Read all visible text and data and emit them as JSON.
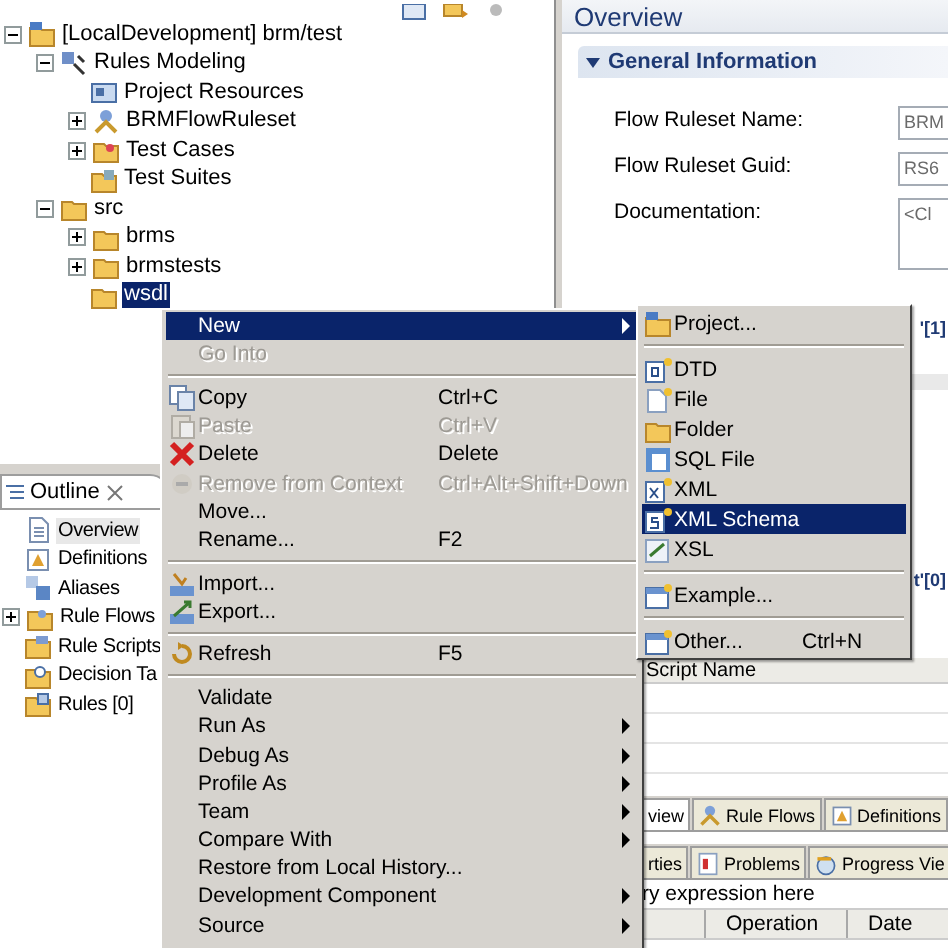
{
  "project_tree": [
    {
      "label": "[LocalDevelopment] brm/test",
      "kind": "project",
      "expanded": true,
      "selected": false,
      "children": [
        {
          "label": "Rules Modeling",
          "kind": "model",
          "expanded": true,
          "selected": false,
          "children": [
            {
              "label": "Project Resources",
              "kind": "resources",
              "selected": false
            },
            {
              "label": "BRMFlowRuleset",
              "kind": "flow",
              "expanded": false,
              "selected": false
            },
            {
              "label": "Test Cases",
              "kind": "cases",
              "expanded": false,
              "selected": false
            },
            {
              "label": "Test Suites",
              "kind": "suites",
              "selected": false
            }
          ]
        },
        {
          "label": "src",
          "kind": "folder",
          "expanded": true,
          "selected": false,
          "children": [
            {
              "label": "brms",
              "kind": "folder",
              "expanded": false,
              "selected": false
            },
            {
              "label": "brmstests",
              "kind": "folder",
              "expanded": false,
              "selected": false
            },
            {
              "label": "wsdl",
              "kind": "folder",
              "selected": true
            }
          ]
        }
      ]
    }
  ],
  "outline": {
    "title": "Outline",
    "items": [
      {
        "label": "Overview",
        "kind": "document",
        "selected": true
      },
      {
        "label": "Definitions",
        "kind": "definition",
        "selected": false
      },
      {
        "label": "Aliases",
        "kind": "alias",
        "selected": false
      },
      {
        "label": "Rule Flows",
        "kind": "flows",
        "expanded": false,
        "selected": false
      },
      {
        "label": "Rule Scripts",
        "kind": "scripts",
        "selected": false
      },
      {
        "label": "Decision Ta",
        "kind": "tables",
        "selected": false
      },
      {
        "label": "Rules [0]",
        "kind": "rules",
        "selected": false
      }
    ]
  },
  "editor": {
    "title": "Overview",
    "section": {
      "title": "General Information",
      "expanded": true
    },
    "fields": [
      {
        "label": "Flow Ruleset Name:",
        "value": "BRM",
        "kind": "line"
      },
      {
        "label": "Flow Ruleset Guid:",
        "value": "RS6",
        "kind": "line"
      },
      {
        "label": "Documentation:",
        "value": "<Cl",
        "kind": "area"
      }
    ],
    "section_2_title": "'[1]",
    "section_3_title": "t'[0]",
    "table_header": "Script Name",
    "tabs": [
      {
        "label": "view",
        "selected": true
      },
      {
        "label": "Rule Flows",
        "selected": false
      },
      {
        "label": "Definitions",
        "selected": false
      }
    ]
  },
  "bottom_panel": {
    "tabs": [
      {
        "label": "rties",
        "kind": "plain",
        "selected": false
      },
      {
        "label": "Problems",
        "kind": "problems",
        "selected": false
      },
      {
        "label": "Progress Vie",
        "kind": "progress",
        "selected": false
      }
    ],
    "query": {
      "value": "ry expression here"
    },
    "columns": [
      "Operation",
      "Date"
    ]
  },
  "context_menu": {
    "items": [
      {
        "kind": "plain",
        "label": "New",
        "selected": true,
        "disabled": false,
        "has_submenu": true
      },
      {
        "kind": "plain",
        "label": "Go Into",
        "selected": false,
        "disabled": true,
        "has_submenu": false
      },
      {
        "kind": "separator"
      },
      {
        "kind": "copy",
        "label": "Copy",
        "shortcut": "Ctrl+C",
        "selected": false,
        "disabled": false,
        "has_submenu": false
      },
      {
        "kind": "paste",
        "label": "Paste",
        "shortcut": "Ctrl+V",
        "selected": false,
        "disabled": true,
        "has_submenu": false
      },
      {
        "kind": "delete",
        "label": "Delete",
        "shortcut": "Delete",
        "selected": false,
        "disabled": false,
        "has_submenu": false
      },
      {
        "kind": "remove",
        "label": "Remove from Context",
        "shortcut": "Ctrl+Alt+Shift+Down",
        "selected": false,
        "disabled": true,
        "has_submenu": false
      },
      {
        "kind": "plain",
        "label": "Move...",
        "selected": false,
        "disabled": false,
        "has_submenu": false
      },
      {
        "kind": "plain",
        "label": "Rename...",
        "shortcut": "F2",
        "selected": false,
        "disabled": false,
        "has_submenu": false
      },
      {
        "kind": "separator"
      },
      {
        "kind": "import",
        "label": "Import...",
        "selected": false,
        "disabled": false,
        "has_submenu": false
      },
      {
        "kind": "export",
        "label": "Export...",
        "selected": false,
        "disabled": false,
        "has_submenu": false
      },
      {
        "kind": "separator"
      },
      {
        "kind": "refresh",
        "label": "Refresh",
        "shortcut": "F5",
        "selected": false,
        "disabled": false,
        "has_submenu": false
      },
      {
        "kind": "separator"
      },
      {
        "kind": "plain",
        "label": "Validate",
        "selected": false,
        "disabled": false,
        "has_submenu": false
      },
      {
        "kind": "plain",
        "label": "Run As",
        "selected": false,
        "disabled": false,
        "has_submenu": true
      },
      {
        "kind": "plain",
        "label": "Debug As",
        "selected": false,
        "disabled": false,
        "has_submenu": true
      },
      {
        "kind": "plain",
        "label": "Profile As",
        "selected": false,
        "disabled": false,
        "has_submenu": true
      },
      {
        "kind": "plain",
        "label": "Team",
        "selected": false,
        "disabled": false,
        "has_submenu": true
      },
      {
        "kind": "plain",
        "label": "Compare With",
        "selected": false,
        "disabled": false,
        "has_submenu": true
      },
      {
        "kind": "plain",
        "label": "Restore from Local History...",
        "selected": false,
        "disabled": false,
        "has_submenu": false
      },
      {
        "kind": "plain",
        "label": "Development Component",
        "selected": false,
        "disabled": false,
        "has_submenu": true
      },
      {
        "kind": "plain",
        "label": "Source",
        "selected": false,
        "disabled": false,
        "has_submenu": true
      }
    ]
  },
  "submenu": {
    "items": [
      {
        "kind": "project",
        "label": "Project...",
        "selected": false
      },
      {
        "kind": "separator"
      },
      {
        "kind": "dtd",
        "label": "DTD",
        "selected": false
      },
      {
        "kind": "file",
        "label": "File",
        "selected": false
      },
      {
        "kind": "folder",
        "label": "Folder",
        "selected": false
      },
      {
        "kind": "sql",
        "label": "SQL File",
        "selected": false
      },
      {
        "kind": "xml",
        "label": "XML",
        "selected": false
      },
      {
        "kind": "schema",
        "label": "XML Schema",
        "selected": true
      },
      {
        "kind": "xsl",
        "label": "XSL",
        "selected": false
      },
      {
        "kind": "separator"
      },
      {
        "kind": "example",
        "label": "Example...",
        "selected": false
      },
      {
        "kind": "separator"
      },
      {
        "kind": "other",
        "label": "Other...",
        "shortcut": "Ctrl+N",
        "selected": false
      }
    ]
  }
}
